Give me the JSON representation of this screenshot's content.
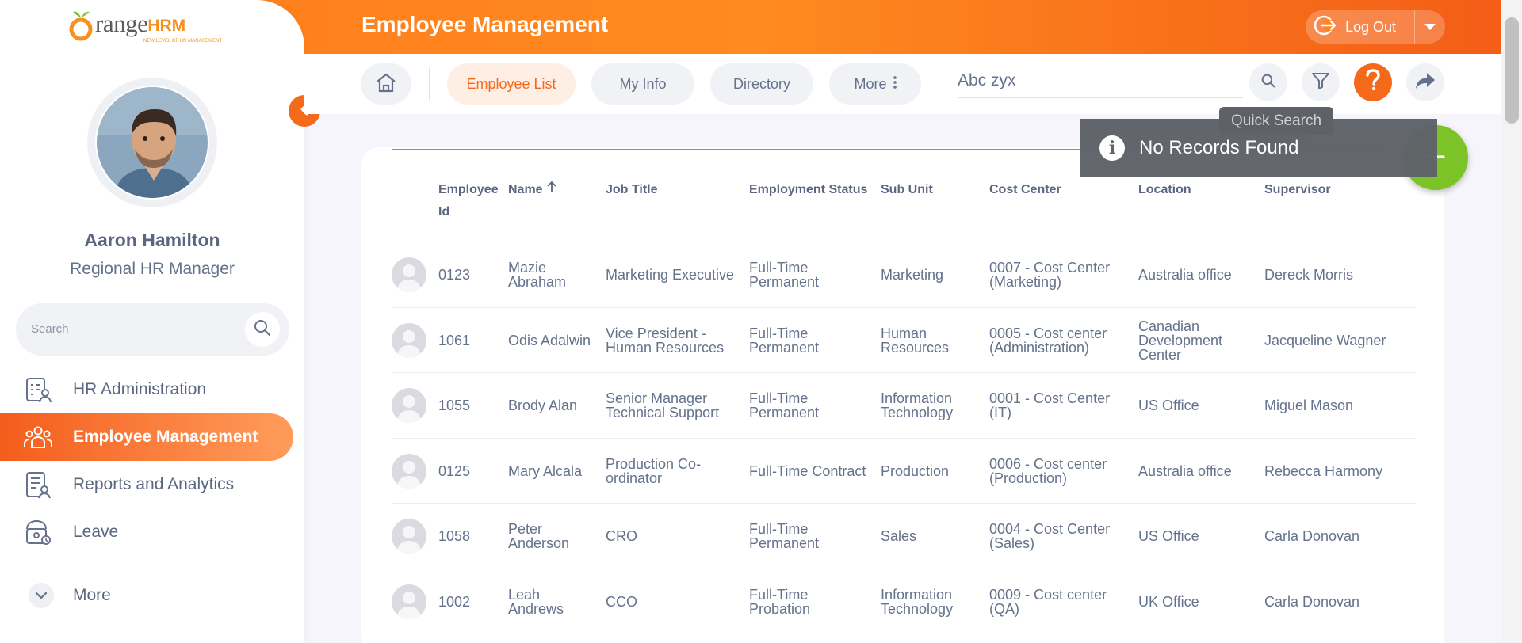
{
  "header": {
    "title": "Employee Management",
    "logout_label": "Log Out"
  },
  "brand": {
    "word": "range",
    "hrm": "HRM",
    "tagline": "NEW LEVEL OF HR MANAGEMENT"
  },
  "user": {
    "name": "Aaron Hamilton",
    "role": "Regional HR Manager"
  },
  "sidebar": {
    "search_placeholder": "Search",
    "items": [
      {
        "label": "HR Administration",
        "icon": "hr-admin-icon",
        "active": false
      },
      {
        "label": "Employee Management",
        "icon": "people-icon",
        "active": true
      },
      {
        "label": "Reports and Analytics",
        "icon": "reports-icon",
        "active": false
      },
      {
        "label": "Leave",
        "icon": "leave-icon",
        "active": false
      }
    ],
    "more_label": "More"
  },
  "subnav": {
    "tabs": [
      {
        "label": "Employee List",
        "active": true
      },
      {
        "label": "My Info",
        "active": false
      },
      {
        "label": "Directory",
        "active": false
      },
      {
        "label": "More",
        "active": false
      }
    ],
    "search_value": "Abc zyx",
    "tooltip": "Quick Search"
  },
  "toast": {
    "message": "No Records Found"
  },
  "table": {
    "columns": [
      "Employee Id",
      "Name",
      "Job Title",
      "Employment Status",
      "Sub Unit",
      "Cost Center",
      "Location",
      "Supervisor"
    ],
    "rows": [
      {
        "id": "0123",
        "name": "Mazie Abraham",
        "job": "Marketing Executive",
        "status": "Full-Time Permanent",
        "subunit": "Marketing",
        "cost": "0007 - Cost Center (Marketing)",
        "location": "Australia office",
        "supervisor": "Dereck Morris"
      },
      {
        "id": "1061",
        "name": "Odis Adalwin",
        "job": "Vice President - Human Resources",
        "status": "Full-Time Permanent",
        "subunit": "Human Resources",
        "cost": "0005 - Cost center (Administration)",
        "location": "Canadian Development Center",
        "supervisor": "Jacqueline Wagner"
      },
      {
        "id": "1055",
        "name": "Brody Alan",
        "job": "Senior Manager Technical Support",
        "status": "Full-Time Permanent",
        "subunit": "Information Technology",
        "cost": "0001 - Cost Center (IT)",
        "location": "US Office",
        "supervisor": "Miguel Mason"
      },
      {
        "id": "0125",
        "name": "Mary Alcala",
        "job": "Production Co-ordinator",
        "status": "Full-Time Contract",
        "subunit": "Production",
        "cost": "0006 - Cost center (Production)",
        "location": "Australia office",
        "supervisor": "Rebecca Harmony"
      },
      {
        "id": "1058",
        "name": "Peter Anderson",
        "job": "CRO",
        "status": "Full-Time Permanent",
        "subunit": "Sales",
        "cost": "0004 - Cost Center (Sales)",
        "location": "US Office",
        "supervisor": "Carla Donovan"
      },
      {
        "id": "1002",
        "name": "Leah Andrews",
        "job": "CCO",
        "status": "Full-Time Probation",
        "subunit": "Information Technology",
        "cost": "0009 - Cost center (QA)",
        "location": "UK Office",
        "supervisor": "Carla Donovan"
      }
    ]
  },
  "colors": {
    "accent": "#f5691a",
    "fab": "#7bc327",
    "toast": "#5e6268"
  }
}
